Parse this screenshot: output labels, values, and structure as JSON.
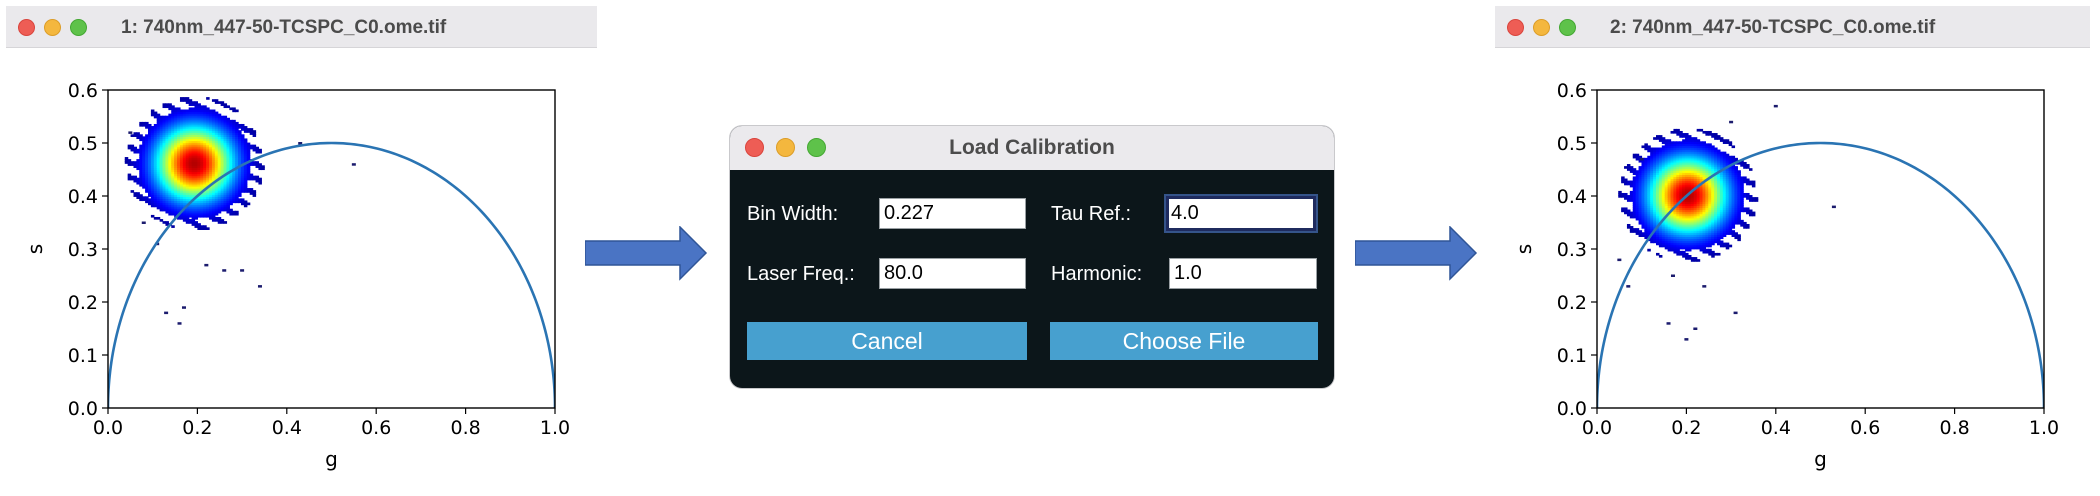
{
  "window_left": {
    "title": "1: 740nm_447-50-TCSPC_C0.ome.tif"
  },
  "window_right": {
    "title": "2: 740nm_447-50-TCSPC_C0.ome.tif"
  },
  "dialog": {
    "title": "Load Calibration",
    "bin_width_label": "Bin Width:",
    "bin_width_value": "0.227",
    "tau_ref_label": "Tau Ref.:",
    "tau_ref_value": "4.0",
    "laser_freq_label": "Laser Freq.:",
    "laser_freq_value": "80.0",
    "harmonic_label": "Harmonic:",
    "harmonic_value": "1.0",
    "cancel_label": "Cancel",
    "choose_file_label": "Choose File"
  },
  "colors": {
    "semicircle": "#2a74b3",
    "arrow": "#4a74c4",
    "dialog_bg": "#0c161a",
    "button": "#47a0cf"
  },
  "chart_data": [
    {
      "type": "scatter",
      "subtype": "phasor-density",
      "title": "",
      "xlabel": "g",
      "ylabel": "s",
      "xlim": [
        0.0,
        1.0
      ],
      "ylim": [
        0.0,
        0.6
      ],
      "xticks": [
        "0.0",
        "0.2",
        "0.4",
        "0.6",
        "0.8",
        "1.0"
      ],
      "yticks": [
        "0.0",
        "0.1",
        "0.2",
        "0.3",
        "0.4",
        "0.5",
        "0.6"
      ],
      "cluster_center": [
        0.19,
        0.46
      ],
      "cluster_spread": [
        0.055,
        0.045
      ],
      "semicircle": {
        "center": [
          0.5,
          0.0
        ],
        "radius": 0.5
      },
      "outliers": [
        [
          0.13,
          0.18
        ],
        [
          0.17,
          0.19
        ],
        [
          0.16,
          0.16
        ],
        [
          0.34,
          0.23
        ],
        [
          0.55,
          0.46
        ],
        [
          0.22,
          0.27
        ],
        [
          0.26,
          0.26
        ],
        [
          0.3,
          0.26
        ],
        [
          0.11,
          0.31
        ],
        [
          0.05,
          0.52
        ],
        [
          0.43,
          0.5
        ],
        [
          0.08,
          0.35
        ]
      ],
      "grid": false
    },
    {
      "type": "scatter",
      "subtype": "phasor-density",
      "title": "",
      "xlabel": "g",
      "ylabel": "s",
      "xlim": [
        0.0,
        1.0
      ],
      "ylim": [
        0.0,
        0.6
      ],
      "xticks": [
        "0.0",
        "0.2",
        "0.4",
        "0.6",
        "0.8",
        "1.0"
      ],
      "yticks": [
        "0.0",
        "0.1",
        "0.2",
        "0.3",
        "0.4",
        "0.5",
        "0.6"
      ],
      "cluster_center": [
        0.2,
        0.4
      ],
      "cluster_spread": [
        0.055,
        0.045
      ],
      "semicircle": {
        "center": [
          0.5,
          0.0
        ],
        "radius": 0.5
      },
      "outliers": [
        [
          0.2,
          0.13
        ],
        [
          0.16,
          0.16
        ],
        [
          0.22,
          0.15
        ],
        [
          0.31,
          0.18
        ],
        [
          0.53,
          0.38
        ],
        [
          0.07,
          0.23
        ],
        [
          0.17,
          0.25
        ],
        [
          0.24,
          0.23
        ],
        [
          0.05,
          0.28
        ],
        [
          0.4,
          0.57
        ],
        [
          0.3,
          0.54
        ],
        [
          0.1,
          0.47
        ]
      ],
      "grid": false
    }
  ]
}
